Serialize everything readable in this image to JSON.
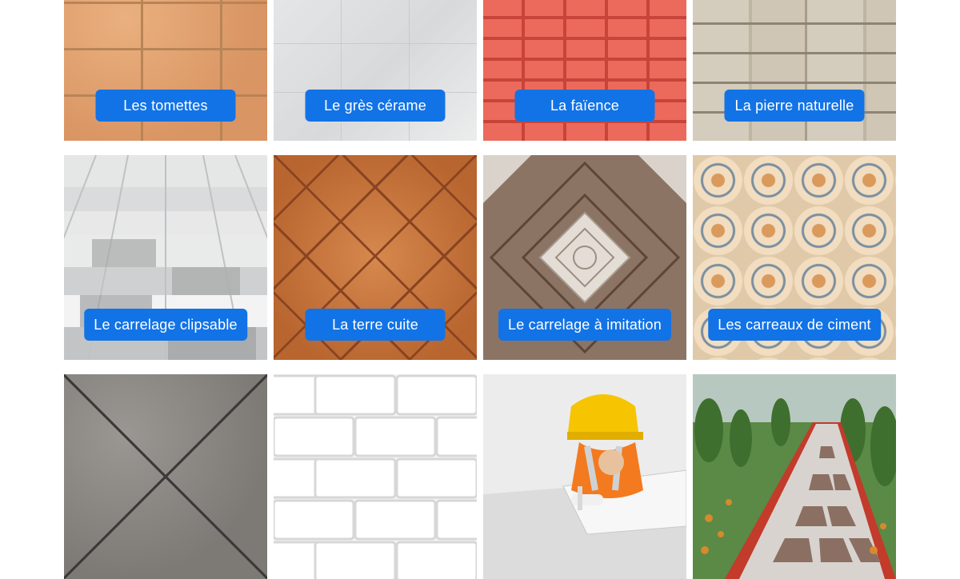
{
  "tiles": [
    {
      "label": "Les tomettes",
      "texture": "terracotta-tiles"
    },
    {
      "label": "Le grès cérame",
      "texture": "grey-porcelain-tiles"
    },
    {
      "label": "La faïence",
      "texture": "red-glazed-tiles"
    },
    {
      "label": "La pierre naturelle",
      "texture": "natural-stone-wall"
    },
    {
      "label": "Le carrelage clipsable",
      "texture": "grey-white-checker-floor"
    },
    {
      "label": "La terre cuite",
      "texture": "diagonal-terracotta"
    },
    {
      "label": "Le carrelage à imitation",
      "texture": "wood-look-pattern"
    },
    {
      "label": "Les carreaux de ciment",
      "texture": "patterned-cement-tiles"
    },
    {
      "label": "",
      "texture": "grey-slate-tiles"
    },
    {
      "label": "",
      "texture": "white-subway-tiles"
    },
    {
      "label": "",
      "texture": "tiler-at-work"
    },
    {
      "label": "",
      "texture": "garden-path-tiles"
    }
  ],
  "colors": {
    "label_background": "#1273e6",
    "label_text": "#ffffff",
    "page_background": "#ffffff"
  }
}
